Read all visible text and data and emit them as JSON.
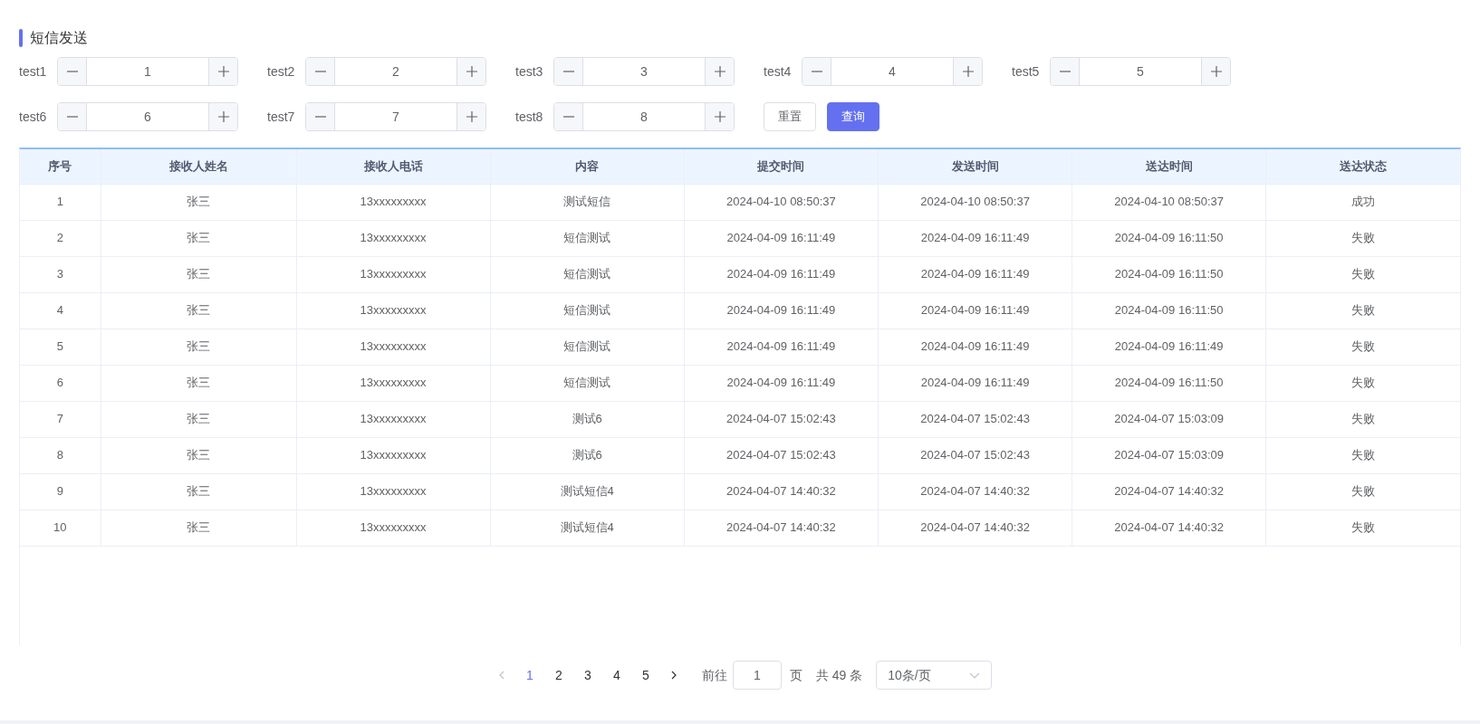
{
  "title": "短信发送",
  "filters": [
    {
      "label": "test1",
      "value": "1"
    },
    {
      "label": "test2",
      "value": "2"
    },
    {
      "label": "test3",
      "value": "3"
    },
    {
      "label": "test4",
      "value": "4"
    },
    {
      "label": "test5",
      "value": "5"
    },
    {
      "label": "test6",
      "value": "6"
    },
    {
      "label": "test7",
      "value": "7"
    },
    {
      "label": "test8",
      "value": "8"
    }
  ],
  "buttons": [
    {
      "label": "重置",
      "kind": "plain"
    },
    {
      "label": "查询",
      "kind": "primary"
    }
  ],
  "table": {
    "columns": [
      "序号",
      "接收人姓名",
      "接收人电话",
      "内容",
      "提交时间",
      "发送时间",
      "送达时间",
      "送达状态"
    ],
    "rows": [
      [
        "1",
        "张三",
        "13xxxxxxxxx",
        "测试短信",
        "2024-04-10 08:50:37",
        "2024-04-10 08:50:37",
        "2024-04-10 08:50:37",
        "成功"
      ],
      [
        "2",
        "张三",
        "13xxxxxxxxx",
        "短信测试",
        "2024-04-09 16:11:49",
        "2024-04-09 16:11:49",
        "2024-04-09 16:11:50",
        "失败"
      ],
      [
        "3",
        "张三",
        "13xxxxxxxxx",
        "短信测试",
        "2024-04-09 16:11:49",
        "2024-04-09 16:11:49",
        "2024-04-09 16:11:50",
        "失败"
      ],
      [
        "4",
        "张三",
        "13xxxxxxxxx",
        "短信测试",
        "2024-04-09 16:11:49",
        "2024-04-09 16:11:49",
        "2024-04-09 16:11:50",
        "失败"
      ],
      [
        "5",
        "张三",
        "13xxxxxxxxx",
        "短信测试",
        "2024-04-09 16:11:49",
        "2024-04-09 16:11:49",
        "2024-04-09 16:11:49",
        "失败"
      ],
      [
        "6",
        "张三",
        "13xxxxxxxxx",
        "短信测试",
        "2024-04-09 16:11:49",
        "2024-04-09 16:11:49",
        "2024-04-09 16:11:50",
        "失败"
      ],
      [
        "7",
        "张三",
        "13xxxxxxxxx",
        "测试6",
        "2024-04-07 15:02:43",
        "2024-04-07 15:02:43",
        "2024-04-07 15:03:09",
        "失败"
      ],
      [
        "8",
        "张三",
        "13xxxxxxxxx",
        "测试6",
        "2024-04-07 15:02:43",
        "2024-04-07 15:02:43",
        "2024-04-07 15:03:09",
        "失败"
      ],
      [
        "9",
        "张三",
        "13xxxxxxxxx",
        "测试短信4",
        "2024-04-07 14:40:32",
        "2024-04-07 14:40:32",
        "2024-04-07 14:40:32",
        "失败"
      ],
      [
        "10",
        "张三",
        "13xxxxxxxxx",
        "测试短信4",
        "2024-04-07 14:40:32",
        "2024-04-07 14:40:32",
        "2024-04-07 14:40:32",
        "失败"
      ]
    ]
  },
  "pagination": {
    "prev_disabled": true,
    "pages": [
      {
        "label": "1",
        "selected": true
      },
      {
        "label": "2",
        "selected": false
      },
      {
        "label": "3",
        "selected": false
      },
      {
        "label": "4",
        "selected": false
      },
      {
        "label": "5",
        "selected": false
      }
    ],
    "jump_label": "前往",
    "jump_value": "1",
    "jump_unit": "页",
    "total": "共 49 条",
    "page_size": "10条/页"
  }
}
